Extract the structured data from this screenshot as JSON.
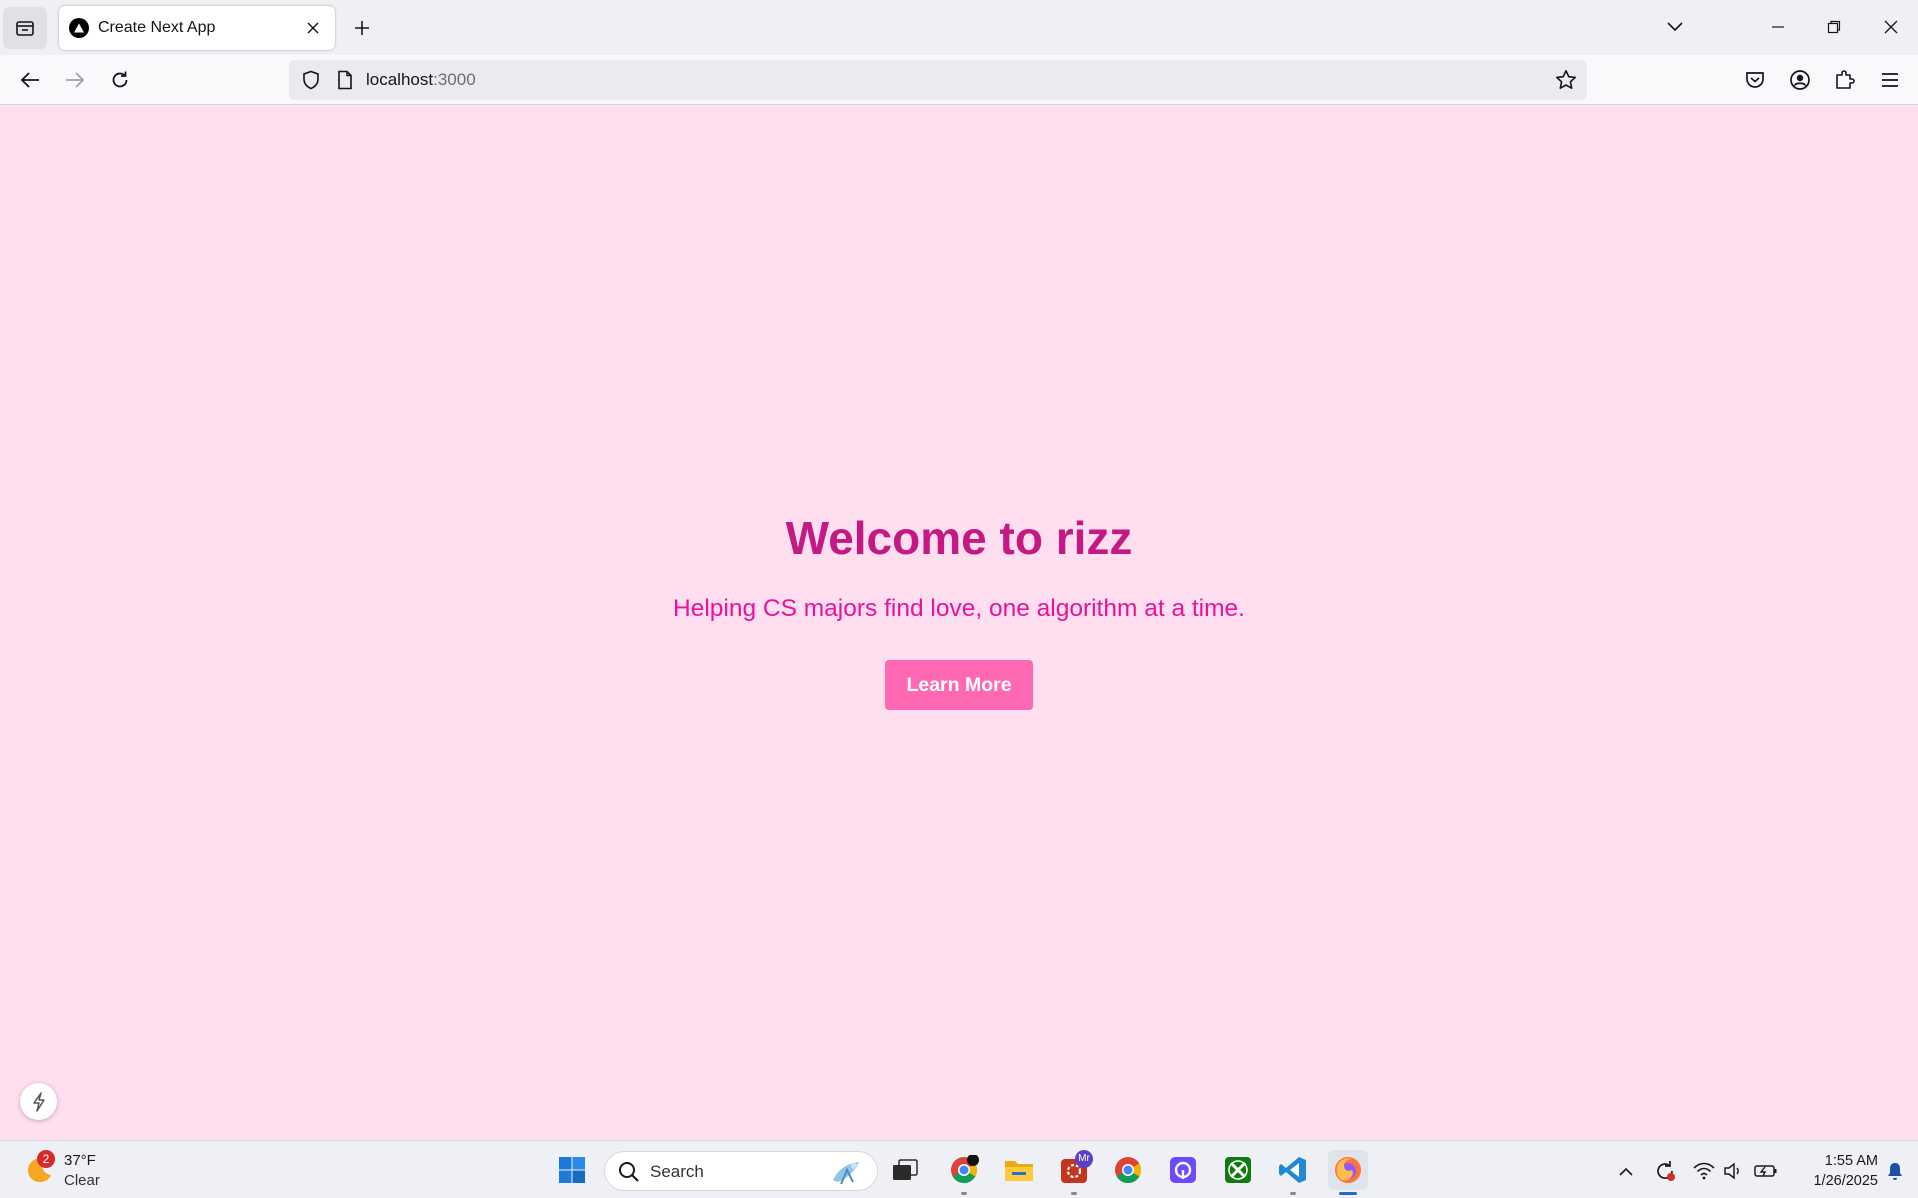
{
  "browser": {
    "tab": {
      "title": "Create Next App"
    },
    "url": {
      "host": "localhost",
      "port": ":3000"
    }
  },
  "page": {
    "title": "Welcome to rizz",
    "subtitle": "Helping CS majors find love, one algorithm at a time.",
    "cta_label": "Learn More",
    "colors": {
      "background": "#ffdeef",
      "title": "#c41882",
      "subtitle": "#e8139a",
      "button": "#ff69b4"
    }
  },
  "taskbar": {
    "weather": {
      "temp": "37°F",
      "condition": "Clear",
      "badge": "2"
    },
    "search_label": "Search",
    "outlook_badge": "Mr",
    "clock": {
      "time": "1:55 AM",
      "date": "1/26/2025"
    },
    "apps": [
      "start-icon",
      "task-view-icon",
      "chrome-icon",
      "file-explorer-icon",
      "outlook-icon",
      "chrome-icon",
      "proton-icon",
      "xbox-icon",
      "vscode-icon",
      "firefox-icon"
    ]
  }
}
